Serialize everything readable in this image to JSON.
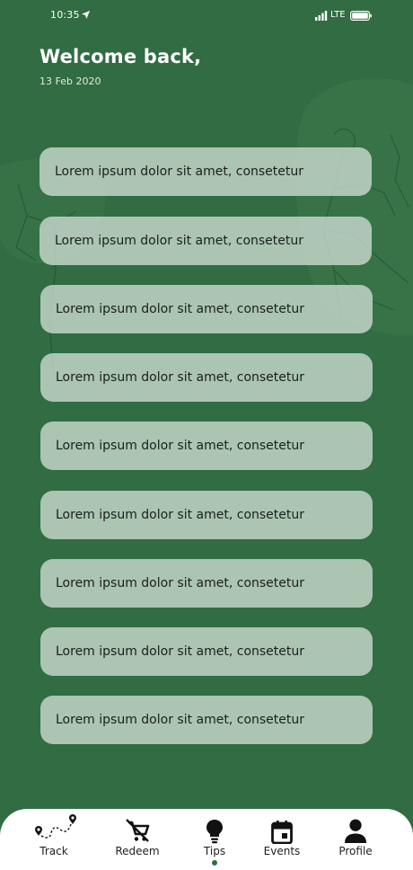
{
  "status_bar": {
    "time": "10:35",
    "network": "LTE",
    "location_icon": "location-arrow-icon",
    "signal_icon": "cellular-signal-icon",
    "battery_icon": "battery-icon"
  },
  "header": {
    "greeting": "Welcome back,",
    "date": "13 Feb 2020"
  },
  "cards": [
    {
      "text": "Lorem ipsum dolor sit amet, consetetur"
    },
    {
      "text": "Lorem ipsum dolor sit amet, consetetur"
    },
    {
      "text": "Lorem ipsum dolor sit amet, consetetur"
    },
    {
      "text": "Lorem ipsum dolor sit amet, consetetur"
    },
    {
      "text": "Lorem ipsum dolor sit amet, consetetur"
    },
    {
      "text": "Lorem ipsum dolor sit amet, consetetur"
    },
    {
      "text": "Lorem ipsum dolor sit amet, consetetur"
    },
    {
      "text": "Lorem ipsum dolor sit amet, consetetur"
    },
    {
      "text": "Lorem ipsum dolor sit amet, consetetur"
    }
  ],
  "bottom_nav": {
    "active": "Tips",
    "items": [
      {
        "label": "Track",
        "icon": "route-icon"
      },
      {
        "label": "Redeem",
        "icon": "no-shopping-cart-icon"
      },
      {
        "label": "Tips",
        "icon": "lightbulb-icon"
      },
      {
        "label": "Events",
        "icon": "calendar-icon"
      },
      {
        "label": "Profile",
        "icon": "person-icon"
      }
    ]
  },
  "colors": {
    "background": "#316c42",
    "card": "#cedad2",
    "nav_background": "#ffffff",
    "accent": "#316c42"
  }
}
